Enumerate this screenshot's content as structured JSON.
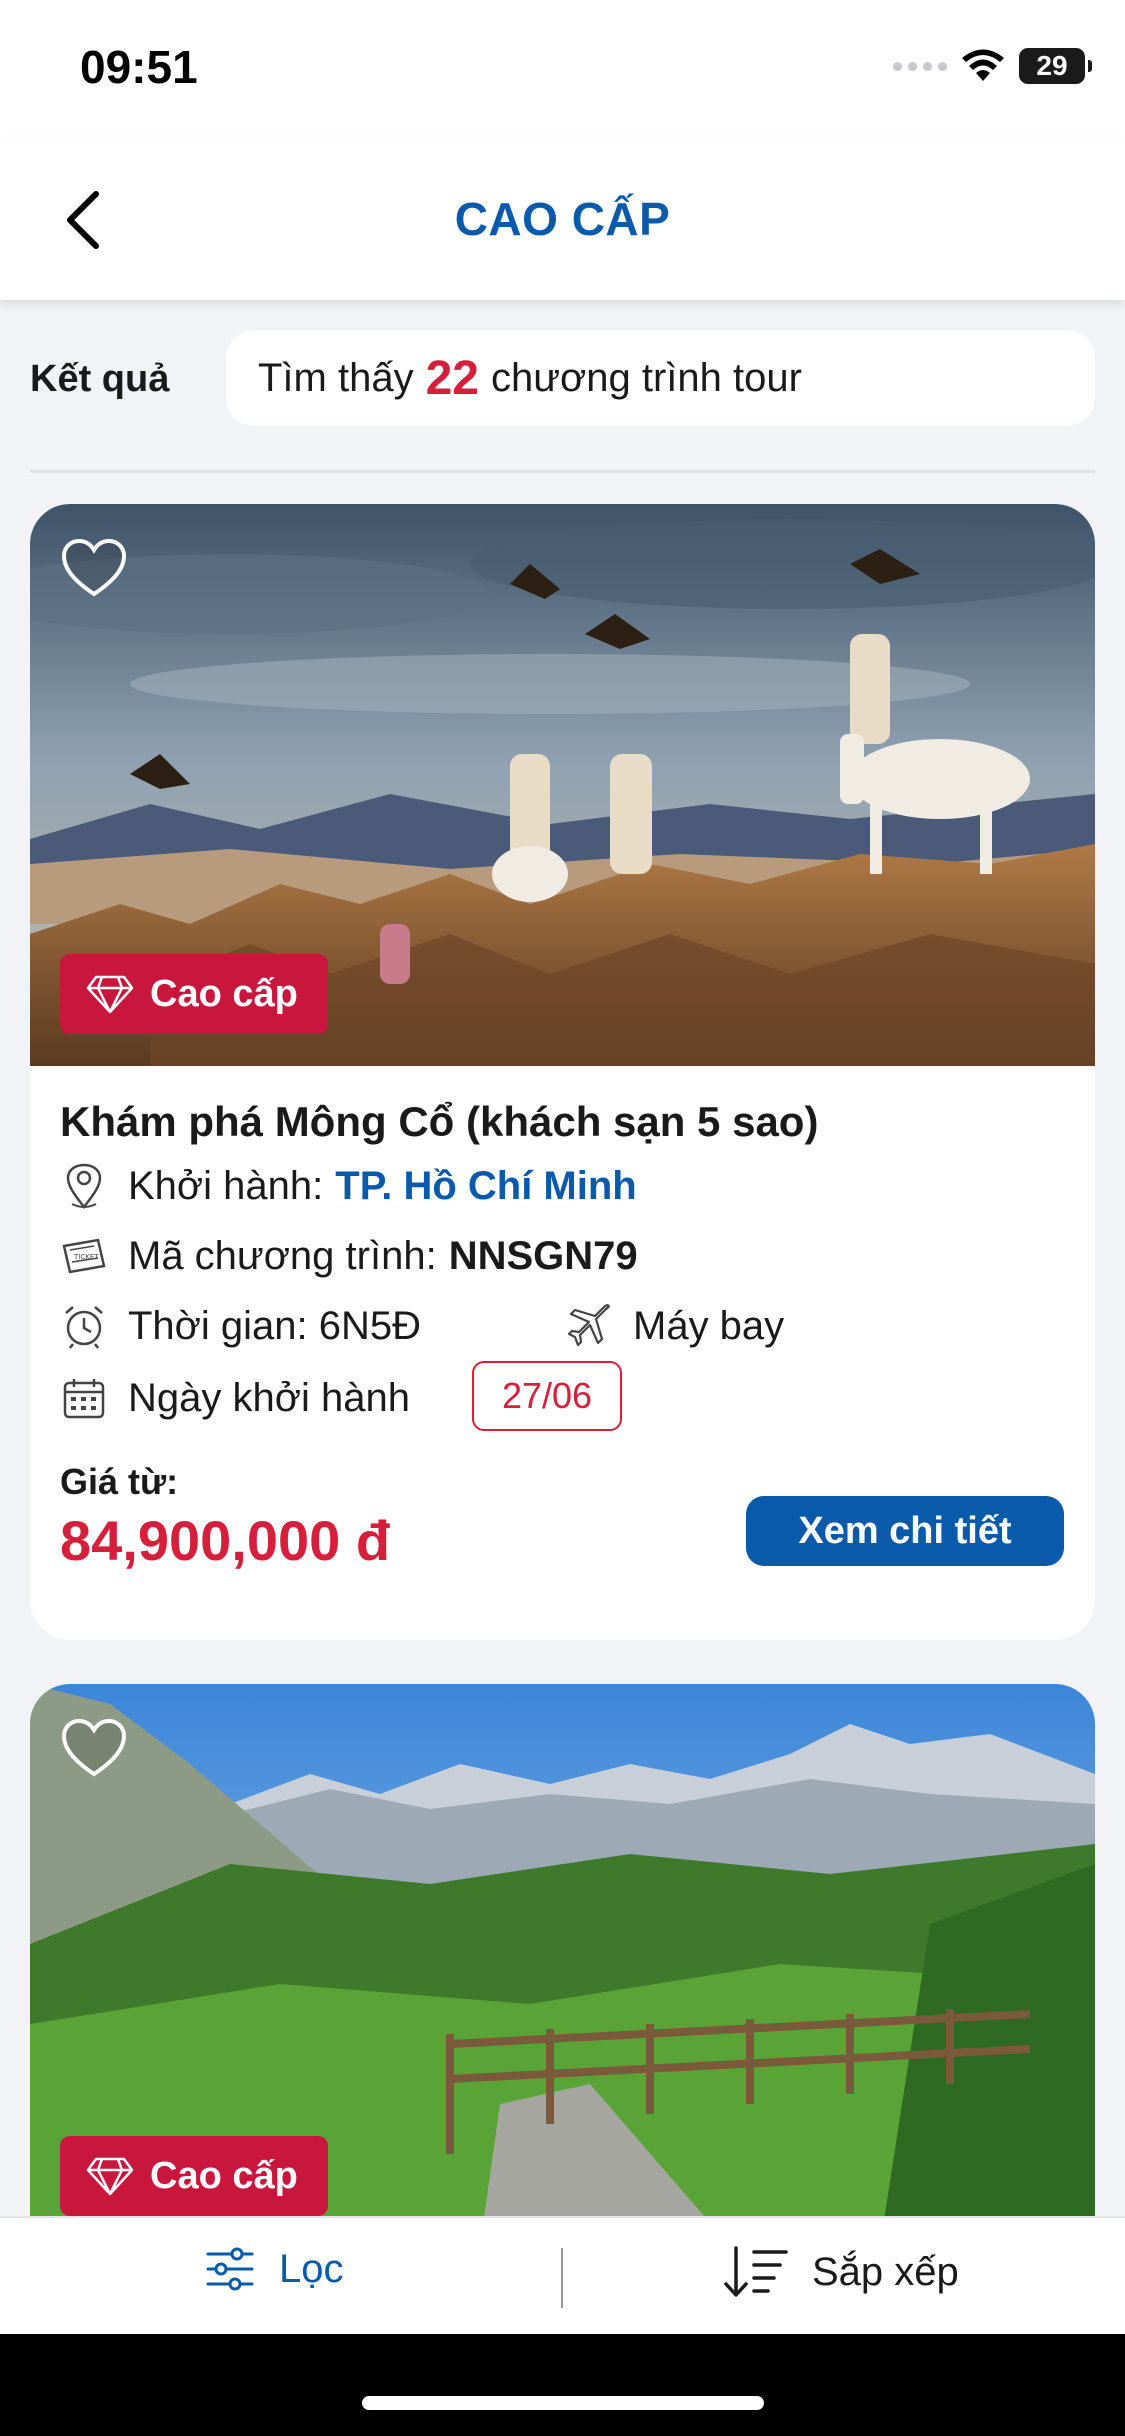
{
  "status": {
    "time": "09:51",
    "battery": "29"
  },
  "header": {
    "title": "CAO CẤP"
  },
  "results": {
    "label": "Kết quả",
    "prefix": "Tìm thấy",
    "count": "22",
    "suffix": "chương trình tour"
  },
  "tours": [
    {
      "badge": "Cao cấp",
      "title": "Khám phá Mông Cổ (khách sạn 5 sao)",
      "departure_label": "Khởi hành:",
      "departure_city": "TP. Hồ Chí Minh",
      "code_label": "Mã chương trình:",
      "code": "NNSGN79",
      "duration_label": "Thời gian: 6N5Đ",
      "transport": "Máy bay",
      "date_label": "Ngày khởi hành",
      "date": "27/06",
      "price_label": "Giá từ:",
      "price": "84,900,000 đ",
      "button": "Xem chi tiết"
    },
    {
      "badge": "Cao cấp"
    }
  ],
  "bottom_bar": {
    "filter": "Lọc",
    "sort": "Sắp xếp"
  },
  "colors": {
    "brand_blue": "#0a5aab",
    "accent_red": "#d51f3b",
    "badge_red": "#c8163c"
  },
  "icons": [
    "back-icon",
    "wifi-icon",
    "heart-icon",
    "diamond-icon",
    "location-pin-icon",
    "ticket-icon",
    "alarm-clock-icon",
    "airplane-icon",
    "calendar-icon",
    "filter-sliders-icon",
    "sort-icon"
  ]
}
